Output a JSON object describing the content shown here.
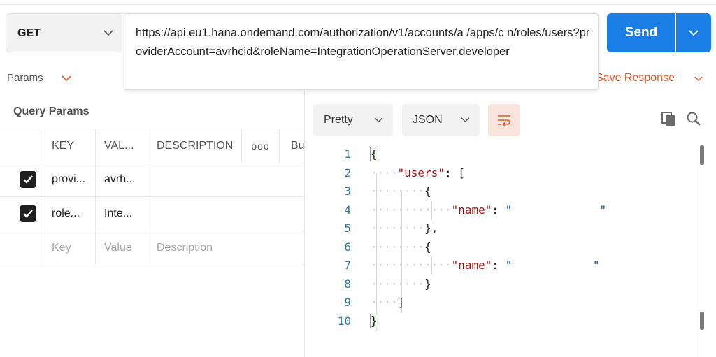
{
  "request": {
    "method": "GET",
    "url": "https://api.eu1.hana.ondemand.com/authorization/v1/accounts/a          /apps/c          n/roles/users?providerAccount=avrhcid&roleName=IntegrationOperationServer.developer",
    "send_label": "Send"
  },
  "tabs": {
    "params_label": "Params"
  },
  "response_actions": {
    "save_label": "Save Response"
  },
  "query_params": {
    "title": "Query Params",
    "headers": {
      "key": "KEY",
      "value": "VAL...",
      "description": "DESCRIPTION",
      "more": "ooo",
      "bulk": "Bu"
    },
    "rows": [
      {
        "checked": true,
        "key": "provi...",
        "value": "avrh...",
        "description": ""
      },
      {
        "checked": true,
        "key": "role...",
        "value": "Inte...",
        "description": ""
      }
    ],
    "placeholders": {
      "key": "Key",
      "value": "Value",
      "description": "Description"
    }
  },
  "response_view": {
    "format_mode": "Pretty",
    "format_type": "JSON"
  },
  "response_body": {
    "line_numbers": [
      "1",
      "2",
      "3",
      "4",
      "5",
      "6",
      "7",
      "8",
      "9",
      "10"
    ],
    "lines": [
      {
        "indent": "",
        "text": "{"
      },
      {
        "indent": "····",
        "key": "\"users\"",
        "rest": ": ["
      },
      {
        "indent": "········",
        "text": "{"
      },
      {
        "indent": "············",
        "key": "\"name\"",
        "rest": ": ",
        "str": "\"             \""
      },
      {
        "indent": "········",
        "text": "},"
      },
      {
        "indent": "········",
        "text": "{"
      },
      {
        "indent": "············",
        "key": "\"name\"",
        "rest": ": ",
        "str": "\"            \""
      },
      {
        "indent": "········",
        "text": "}"
      },
      {
        "indent": "····",
        "text": "]"
      },
      {
        "indent": "",
        "text": "}"
      }
    ]
  },
  "icons": {
    "method_dropdown": "chevron-down-icon",
    "send_dropdown": "chevron-down-icon",
    "wrap": "wrap-lines-icon",
    "copy": "copy-icon",
    "search": "search-icon",
    "checkbox": "checkmark-icon"
  },
  "colors": {
    "accent": "#1a7ee6",
    "orange": "#e05a2b",
    "json_key": "#a31515",
    "json_string": "#0451a5",
    "line_number": "#2a7a9e"
  }
}
